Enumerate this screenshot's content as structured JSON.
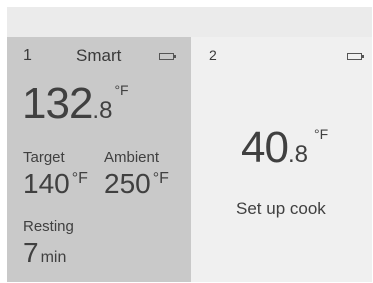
{
  "probes": [
    {
      "number": "1",
      "mode": "Smart",
      "battery": 1.0,
      "current_int": "132",
      "current_dec": ".8",
      "current_unit": "°F",
      "target_label": "Target",
      "target_value": "140",
      "target_unit": "°F",
      "ambient_label": "Ambient",
      "ambient_value": "250",
      "ambient_unit": "°F",
      "resting_label": "Resting",
      "resting_value": "7",
      "resting_unit": "min"
    },
    {
      "number": "2",
      "battery": 1.0,
      "current_int": "40",
      "current_dec": ".8",
      "current_unit": "°F",
      "action_label": "Set up cook"
    }
  ],
  "colors": {
    "selected_panel": "#c9c9c9",
    "panel": "#f0f0f0",
    "text": "#404040"
  }
}
